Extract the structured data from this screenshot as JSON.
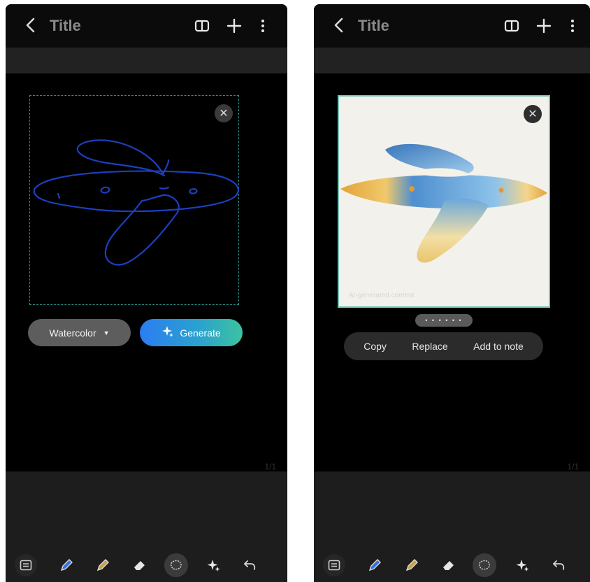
{
  "screens": [
    {
      "header": {
        "back_label": "<",
        "title": "Title"
      },
      "page_indicator": "1/1",
      "controls": {
        "style_label": "Watercolor",
        "generate_label": "Generate"
      }
    },
    {
      "header": {
        "back_label": "<",
        "title": "Title"
      },
      "page_indicator": "1/1",
      "image": {
        "watermark": "AI-generated content"
      },
      "pager_dots": "• • • • • •",
      "context_menu": {
        "copy": "Copy",
        "replace": "Replace",
        "add_to_note": "Add to note"
      }
    }
  ],
  "colors": {
    "background": "#000000",
    "bar": "#1d1d1d",
    "sketch_stroke": "#1c3fbf",
    "generate_gradient": [
      "#2b7df2",
      "#3cc3a0"
    ],
    "selection_border": "#6fc7b5"
  },
  "icons": {
    "toolbar": [
      "text-box-icon",
      "pen-icon",
      "highlighter-icon",
      "eraser-icon",
      "lasso-icon",
      "ai-assist-icon",
      "undo-icon"
    ],
    "header": [
      "back-icon",
      "reading-mode-icon",
      "add-icon",
      "more-icon"
    ]
  }
}
